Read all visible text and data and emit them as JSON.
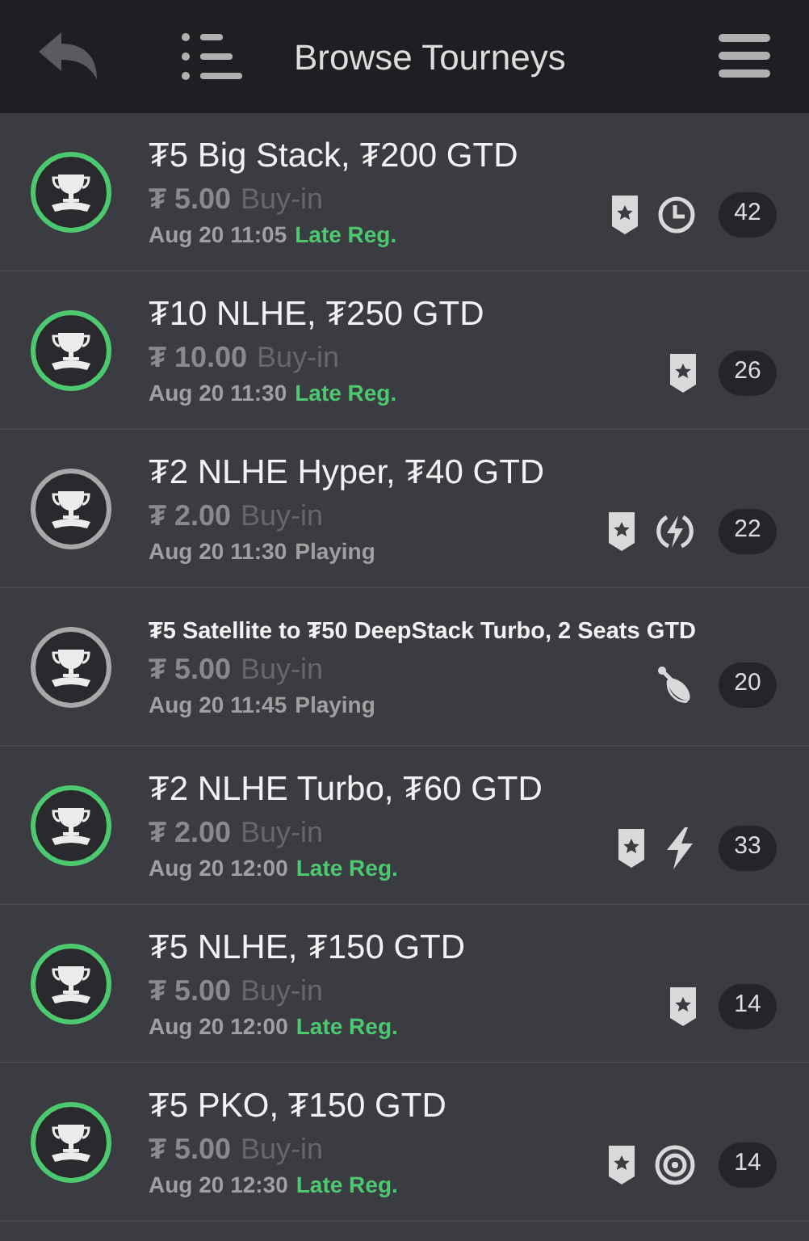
{
  "header": {
    "title": "Browse Tourneys"
  },
  "tourneys": [
    {
      "title": "₮5 Big Stack, ₮200 GTD",
      "price": "₮ 5.00",
      "buyin": "Buy-in",
      "time": "Aug 20 11:05",
      "status": {
        "kind": "late_reg",
        "label": "Late Reg."
      },
      "icons": [
        {
          "kind": "badge"
        },
        {
          "kind": "clock"
        }
      ],
      "count": "42"
    },
    {
      "title": "₮10 NLHE, ₮250 GTD",
      "price": "₮ 10.00",
      "buyin": "Buy-in",
      "time": "Aug 20 11:30",
      "status": {
        "kind": "late_reg",
        "label": "Late Reg."
      },
      "icons": [
        {
          "kind": "badge"
        }
      ],
      "count": "26"
    },
    {
      "title": "₮2 NLHE Hyper, ₮40 GTD",
      "price": "₮ 2.00",
      "buyin": "Buy-in",
      "time": "Aug 20 11:30",
      "status": {
        "kind": "playing",
        "label": "Playing"
      },
      "icons": [
        {
          "kind": "badge"
        },
        {
          "kind": "bolt_circle"
        }
      ],
      "count": "22"
    },
    {
      "title": "₮5 Satellite to ₮50 DeepStack Turbo, 2 Seats GTD",
      "price": "₮ 5.00",
      "buyin": "Buy-in",
      "time": "Aug 20 11:45",
      "status": {
        "kind": "playing",
        "label": "Playing"
      },
      "icons": [
        {
          "kind": "satellite"
        }
      ],
      "count": "20"
    },
    {
      "title": "₮2 NLHE Turbo, ₮60 GTD",
      "price": "₮ 2.00",
      "buyin": "Buy-in",
      "time": "Aug 20 12:00",
      "status": {
        "kind": "late_reg",
        "label": "Late Reg."
      },
      "icons": [
        {
          "kind": "badge"
        },
        {
          "kind": "bolt"
        }
      ],
      "count": "33"
    },
    {
      "title": "₮5 NLHE, ₮150 GTD",
      "price": "₮ 5.00",
      "buyin": "Buy-in",
      "time": "Aug 20 12:00",
      "status": {
        "kind": "late_reg",
        "label": "Late Reg."
      },
      "icons": [
        {
          "kind": "badge"
        }
      ],
      "count": "14"
    },
    {
      "title": "₮5 PKO, ₮150 GTD",
      "price": "₮ 5.00",
      "buyin": "Buy-in",
      "time": "Aug 20 12:30",
      "status": {
        "kind": "late_reg",
        "label": "Late Reg."
      },
      "icons": [
        {
          "kind": "badge"
        },
        {
          "kind": "target"
        }
      ],
      "count": "14"
    }
  ]
}
